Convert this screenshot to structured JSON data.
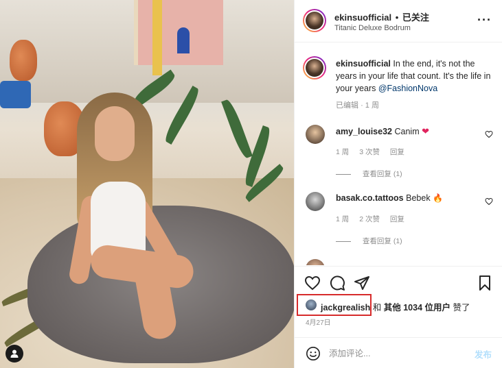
{
  "post": {
    "username": "ekinsuofficial",
    "follow_status": "已关注",
    "separator": "•",
    "location": "Titanic Deluxe Bodrum"
  },
  "caption": {
    "username": "ekinsuofficial",
    "text": "In the end, it's not the years in your life that count. It's the life in your years",
    "mention": "@FashionNova",
    "edited": "已编辑",
    "time": "1 周"
  },
  "comments": [
    {
      "username": "amy_louise32",
      "text": "Canim",
      "emoji": "❤",
      "time": "1 周",
      "likes": "3 次赞",
      "reply": "回复",
      "view_replies": "查看回复 (1)"
    },
    {
      "username": "basak.co.tattoos",
      "text": "Bebek",
      "emoji": "🔥",
      "time": "1 周",
      "likes": "2 次赞",
      "reply": "回复",
      "view_replies": "查看回复 (1)"
    }
  ],
  "likes": {
    "liker": "jackgrealish",
    "connector": "和",
    "others": "其他 1034 位用户",
    "suffix": "赞了"
  },
  "date": "4月27日",
  "comment_box": {
    "placeholder": "添加评论...",
    "post_label": "发布"
  },
  "colors": {
    "highlight": "#d62a2a",
    "link": "#00376b",
    "post_button": "#b2dffc",
    "heart_red": "#e0245e"
  }
}
